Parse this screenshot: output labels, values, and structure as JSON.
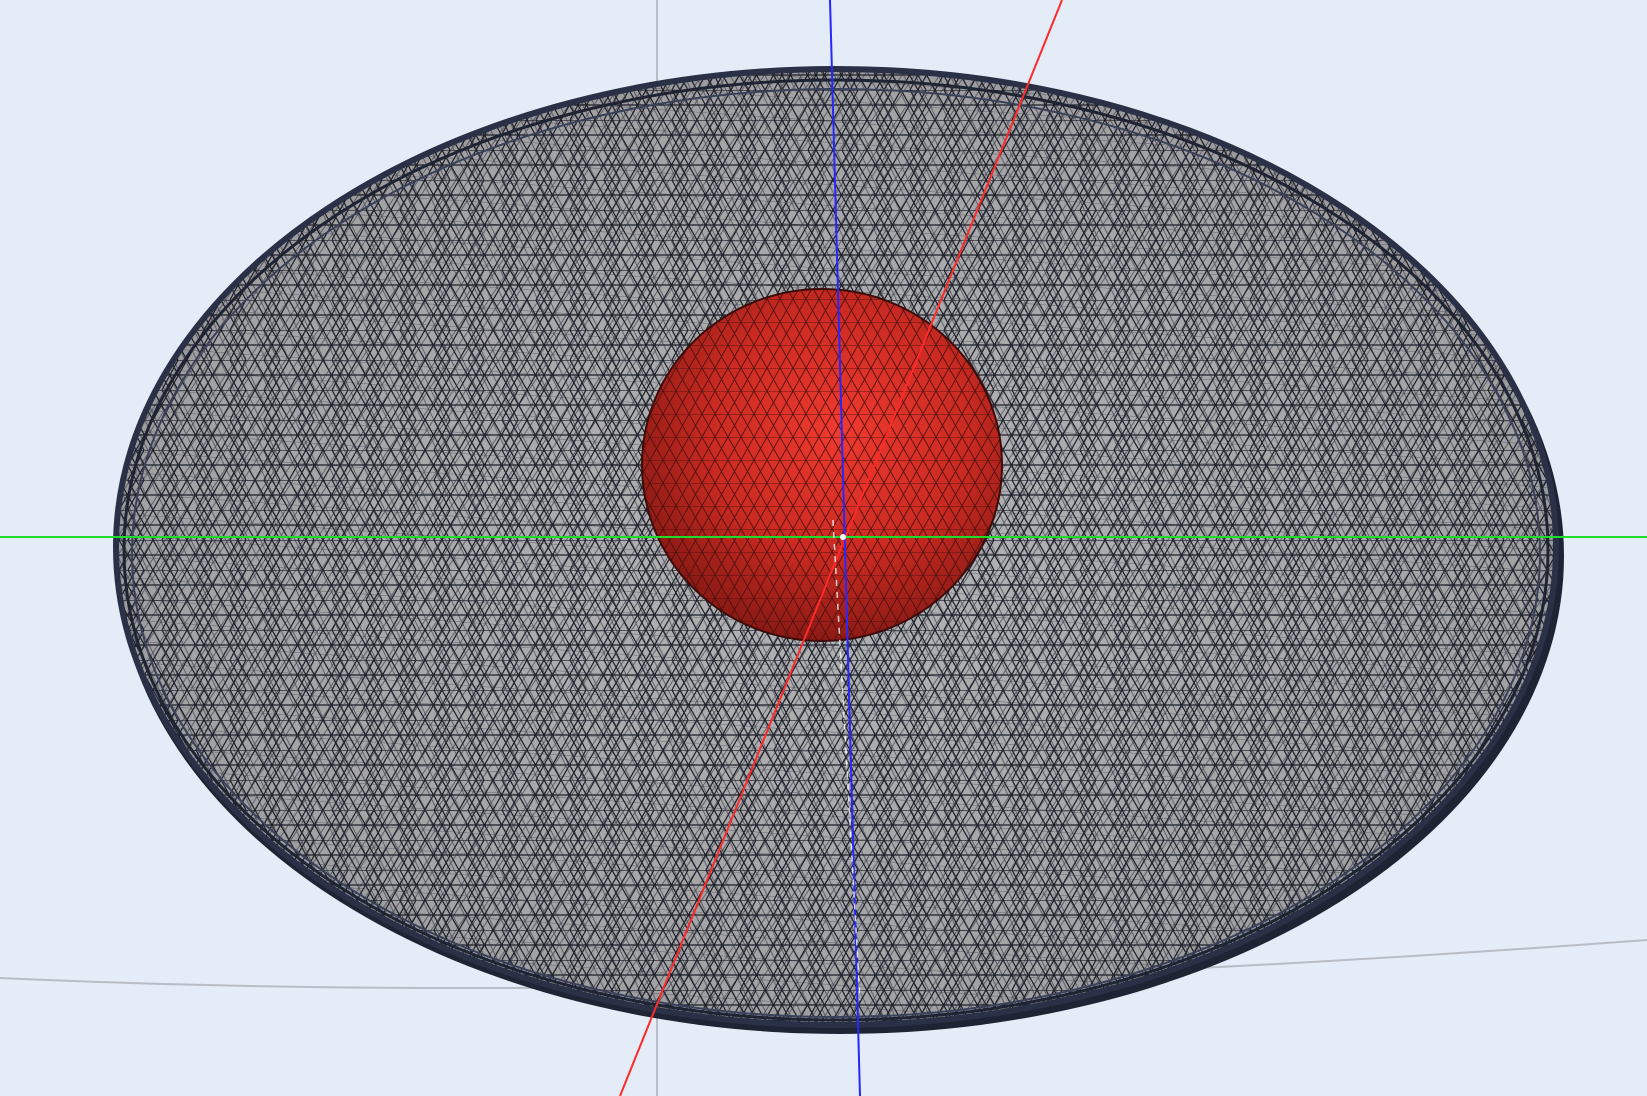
{
  "viewport": {
    "background_color": "#e3ecf7"
  },
  "scene": {
    "outer_body": {
      "fill_color": "#a9a9ab",
      "edge_color": "#1e2433",
      "rim_color": "#2a3146"
    },
    "inner_sphere": {
      "fill_color": "#c92a22",
      "highlight_color": "#f03a30",
      "edge_color": "#3b0c0a"
    },
    "axes": {
      "x_color": "#ff2a2a",
      "y_color": "#1ddc2b",
      "z_color": "#2727ff"
    },
    "guide_lines_color": "#b8bcc4",
    "rendering": "wireframe-over-shaded"
  }
}
